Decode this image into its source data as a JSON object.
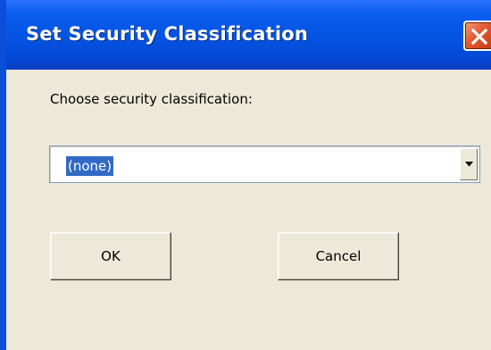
{
  "dialog": {
    "title": "Set Security Classification",
    "prompt": "Choose security classification:",
    "selected_value": "(none)",
    "ok_label": "OK",
    "cancel_label": "Cancel"
  },
  "icons": {
    "close": "close-icon",
    "dropdown": "chevron-down-icon"
  },
  "colors": {
    "titlebar": "#0554e3",
    "dialog_bg": "#ece9d8",
    "selection": "#316ac5",
    "close_button": "#e45a33"
  }
}
